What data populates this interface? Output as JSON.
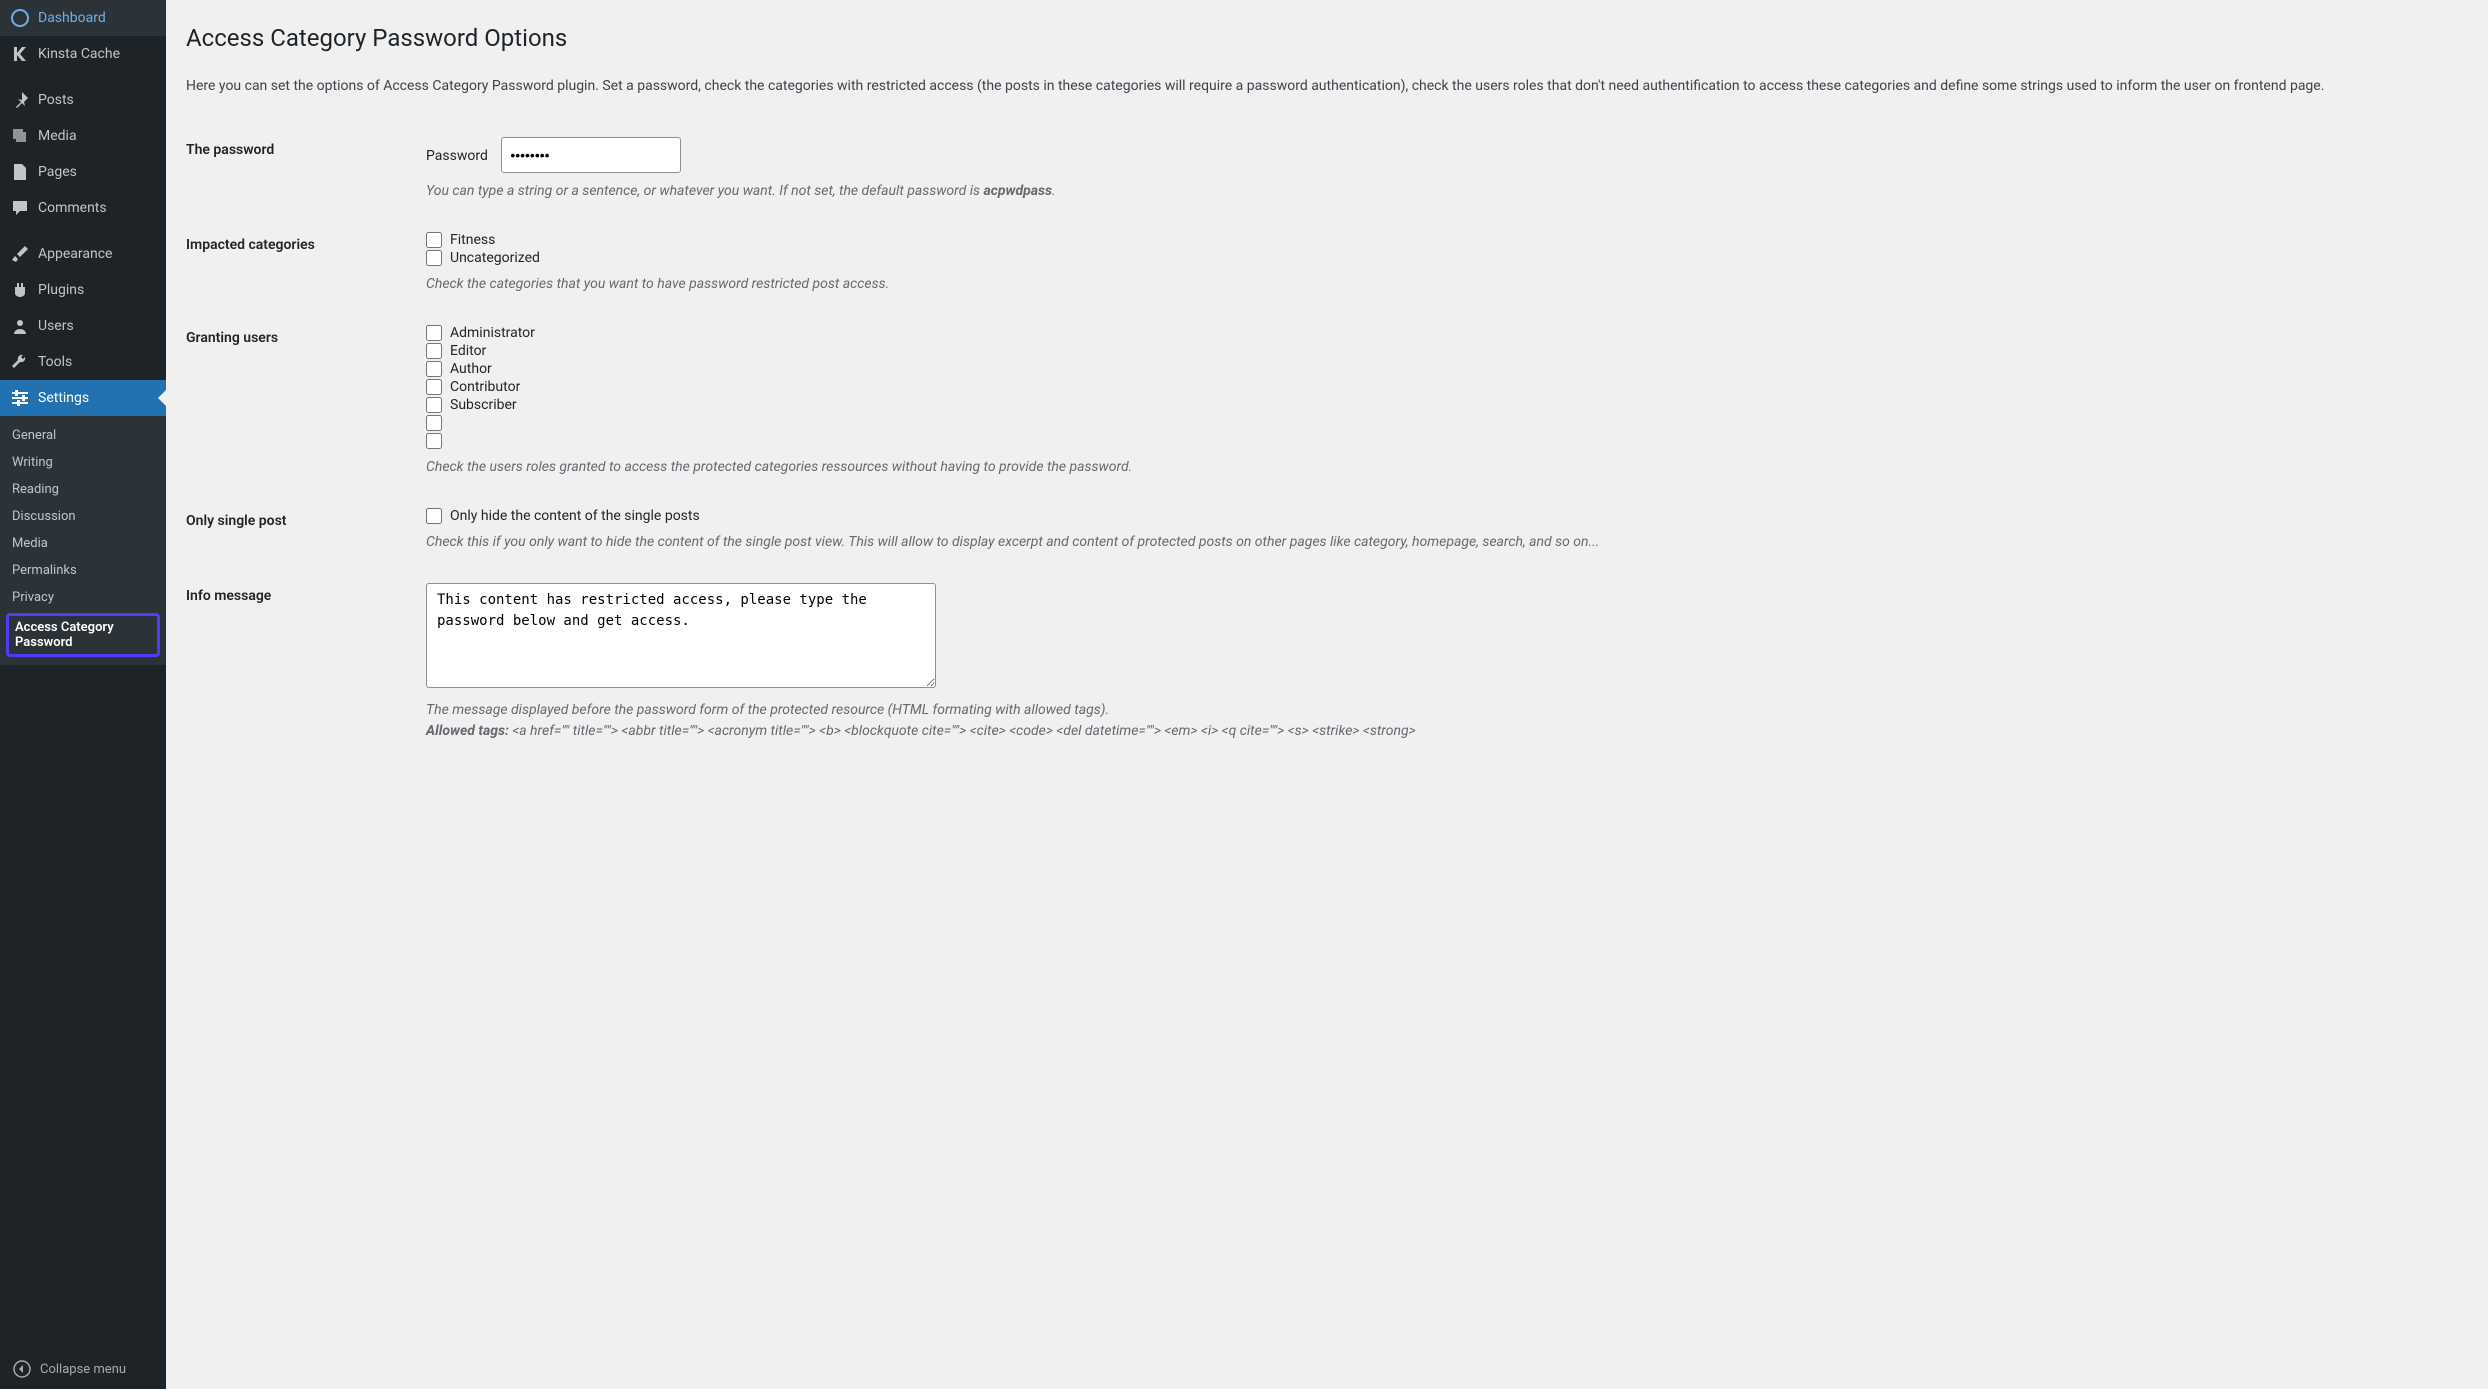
{
  "sidebar": {
    "items": [
      {
        "label": "Dashboard",
        "icon": "dashboard"
      },
      {
        "label": "Kinsta Cache",
        "icon": "kinsta"
      },
      {
        "label": "Posts",
        "icon": "pin"
      },
      {
        "label": "Media",
        "icon": "media"
      },
      {
        "label": "Pages",
        "icon": "page"
      },
      {
        "label": "Comments",
        "icon": "comment"
      },
      {
        "label": "Appearance",
        "icon": "brush"
      },
      {
        "label": "Plugins",
        "icon": "plug"
      },
      {
        "label": "Users",
        "icon": "user"
      },
      {
        "label": "Tools",
        "icon": "wrench"
      },
      {
        "label": "Settings",
        "icon": "sliders"
      }
    ],
    "submenu": [
      "General",
      "Writing",
      "Reading",
      "Discussion",
      "Media",
      "Permalinks",
      "Privacy",
      "Access Category Password"
    ],
    "collapse": "Collapse menu"
  },
  "page": {
    "title": "Access Category Password Options",
    "intro": "Here you can set the options of Access Category Password plugin. Set a password, check the categories with restricted access (the posts in these categories will require a password authentication), check the users roles that don't need authentification to access these categories and define some strings used to inform the user on frontend page."
  },
  "fields": {
    "password": {
      "row_label": "The password",
      "input_label": "Password",
      "value": "••••••••",
      "desc_pre": "You can type a string or a sentence, or whatever you want. If not set, the default password is ",
      "default_pw": "acpwdpass",
      "desc_post": "."
    },
    "categories": {
      "row_label": "Impacted categories",
      "options": [
        "Fitness",
        "Uncategorized"
      ],
      "desc": "Check the categories that you want to have password restricted post access."
    },
    "users": {
      "row_label": "Granting users",
      "options": [
        "Administrator",
        "Editor",
        "Author",
        "Contributor",
        "Subscriber",
        "",
        ""
      ],
      "desc": "Check the users roles granted to access the protected categories ressources without having to provide the password."
    },
    "single": {
      "row_label": "Only single post",
      "option": "Only hide the content of the single posts",
      "desc": "Check this if you only want to hide the content of the single post view. This will allow to display excerpt and content of protected posts on other pages like category, homepage, search, and so on..."
    },
    "info": {
      "row_label": "Info message",
      "value": "This content has restricted access, please type the password below and get access.",
      "desc": "The message displayed before the password form of the protected resource (HTML formating with allowed tags).",
      "allowed_label": "Allowed tags:",
      "allowed_tags": " <a href=\"\" title=\"\"> <abbr title=\"\"> <acronym title=\"\"> <b> <blockquote cite=\"\"> <cite> <code> <del datetime=\"\"> <em> <i> <q cite=\"\"> <s> <strike> <strong>"
    }
  }
}
